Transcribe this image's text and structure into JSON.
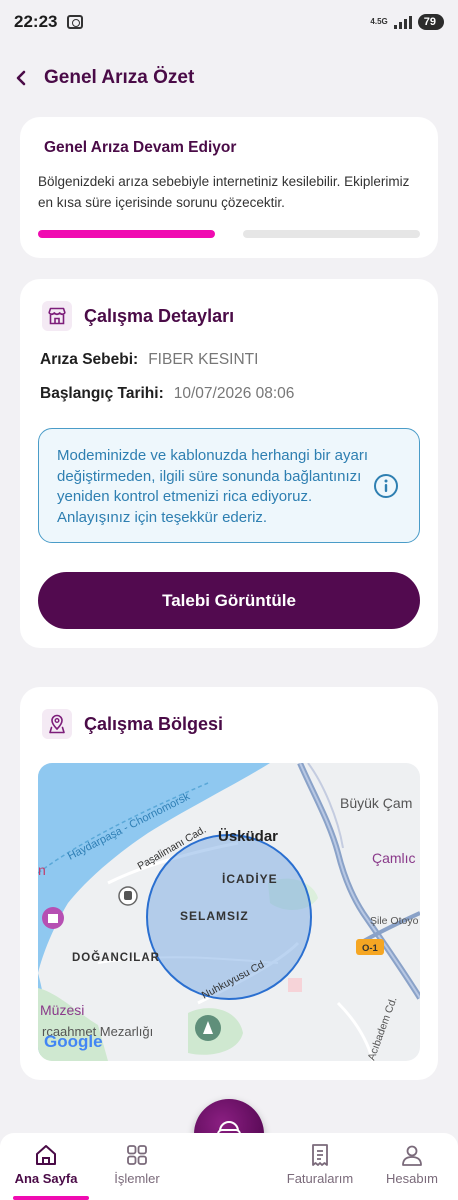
{
  "status_bar": {
    "time": "22:23",
    "network": "4.5G",
    "battery": "79"
  },
  "header": {
    "title": "Genel Arıza Özet"
  },
  "outage": {
    "title": "Genel Arıza Devam Ediyor",
    "description": "Bölgenizdeki  arıza sebebiyle internetiniz kesilebilir. Ekiplerimiz en kısa süre içerisinde sorunu çözecektir.",
    "progress_segments": 2,
    "progress_completed": 1,
    "colors": {
      "active": "#f00bb1",
      "inactive": "#e6e6e6"
    }
  },
  "details": {
    "title": "Çalışma Detayları",
    "icon": "storefront-icon",
    "rows": [
      {
        "label": "Arıza Sebebi:",
        "value": "FIBER KESINTI"
      },
      {
        "label": "Başlangıç Tarihi:",
        "value": "10/07/2026 08:06"
      }
    ],
    "info_text": "Modeminizde ve kablonuzda herhangi bir ayarı değiştirmeden, ilgili süre sonunda bağlantınızı yeniden kontrol etmenizi rica ediyoruz. Anlayışınız için teşekkür ederiz.",
    "button_label": "Talebi Görüntüle"
  },
  "region": {
    "title": "Çalışma Bölgesi",
    "icon": "map-pin-icon",
    "map_labels": {
      "uskudar": "Üsküdar",
      "icadiye": "İCADİYE",
      "selamsiz": "SELAMSIZ",
      "dogancilar": "DOĞANCILAR",
      "buyuk_cam": "Büyük Çam",
      "camlic": "Çamlıc",
      "sile": "Şile Otoyo",
      "o1": "O-1",
      "haydarpasa": "Haydarpaşa - Chornomorsk",
      "pasalimani": "Paşalimanı Cad.",
      "nuhkuyusu": "Nuhkuyusu Cd",
      "muzesi": "Müzesi",
      "mezarligi": "rcaahmet Mezarlığı",
      "acibadem": "Acıbadem Cd.",
      "google": "Google",
      "left_n": "n"
    }
  },
  "bottom_nav": {
    "items": [
      {
        "label": "Ana Sayfa",
        "icon": "home-icon",
        "active": true
      },
      {
        "label": "İşlemler",
        "icon": "grid-icon",
        "active": false
      },
      {
        "label": "Faturalarım",
        "icon": "invoice-icon",
        "active": false
      },
      {
        "label": "Hesabım",
        "icon": "user-icon",
        "active": false
      }
    ],
    "fab_icon": "chat-support-icon"
  }
}
